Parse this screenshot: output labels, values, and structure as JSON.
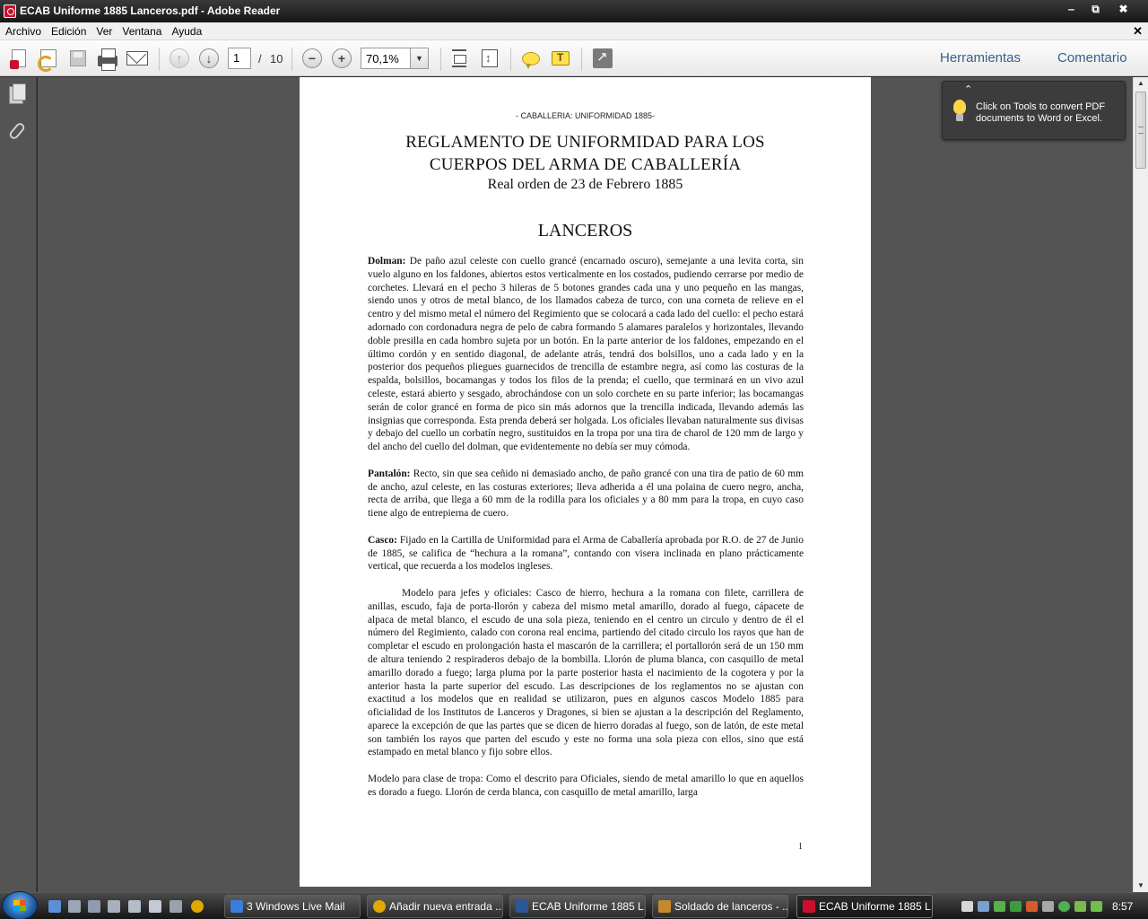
{
  "window": {
    "title": "ECAB Uniforme 1885 Lanceros.pdf - Adobe Reader",
    "minimize": "‒",
    "restore": "⧉",
    "close": "✖"
  },
  "menu": {
    "items": [
      "Archivo",
      "Edición",
      "Ver",
      "Ventana",
      "Ayuda"
    ],
    "doc_close": "✕"
  },
  "toolbar": {
    "page_current": "1",
    "page_separator": "/",
    "page_total": "10",
    "zoom": "70,1%",
    "zoom_arrow": "▼",
    "herramientas": "Herramientas",
    "comentario": "Comentario",
    "icons": {
      "create": "create-pdf-icon",
      "open": "open-icon",
      "save": "save-icon",
      "print": "print-icon",
      "email": "email-icon",
      "prev": "previous-page-icon",
      "next": "next-page-icon",
      "zoom_out": "zoom-out-icon",
      "zoom_in": "zoom-in-icon",
      "fit_page": "fit-page-icon",
      "fit_width": "fit-width-icon",
      "comment": "sticky-note-icon",
      "highlight": "highlight-text-icon",
      "fullscreen": "full-screen-icon"
    }
  },
  "tooltip": {
    "collapse": "⌃",
    "text": "Click on Tools to convert PDF documents to Word or Excel."
  },
  "document": {
    "header": "- CABALLERIA: UNIFORMIDAD 1885-",
    "title_line1": "REGLAMENTO DE UNIFORMIDAD PARA LOS",
    "title_line2": "CUERPOS DEL ARMA DE CABALLERÍA",
    "subtitle": "Real orden de 23 de Febrero 1885",
    "section": "LANCEROS",
    "paragraphs": [
      {
        "term": "Dolman:",
        "text": " De paño azul celeste con cuello grancé (encarnado oscuro), semejante a una levita corta, sin vuelo alguno en los faldones, abiertos estos verticalmente en los costados, pudiendo cerrarse por medio de corchetes. Llevará en el pecho 3 hileras de 5 botones grandes cada una y uno pequeño en las mangas, siendo unos y otros de metal blanco, de los llamados cabeza de turco, con una corneta de relieve en el centro y del mismo metal el número del Regimiento que se colocará a cada lado del cuello: el pecho estará adornado con cordonadura negra de pelo de cabra formando 5 alamares paralelos y horizontales, llevando doble presilla en cada hombro sujeta por un botón. En la parte anterior de los faldones, empezando en el último cordón y en sentido diagonal, de adelante atrás, tendrá dos bolsillos, uno a cada lado y en la posterior dos pequeños pliegues guarnecidos de trencilla de estambre negra, así como las costuras de la espalda, bolsillos, bocamangas y todos los filos de la prenda; el cuello, que terminará en un vivo azul celeste, estará abierto y sesgado, abrochándose con un solo corchete en su parte inferior; las bocamangas serán de color grancé en forma de pico sin más adornos que la trencilla indicada, llevando además las insignias que corresponda. Esta prenda deberá ser holgada. Los oficiales llevaban naturalmente sus divisas y debajo del cuello un corbatín negro, sustituidos en la tropa por una tira de charol de 120 mm de largo y del ancho del cuello del dolman, que evidentemente no debía ser muy cómoda."
      },
      {
        "term": "Pantalón:",
        "text": " Recto, sin que sea ceñido ni demasiado ancho, de paño grancé con una tira de patio de 60 mm de ancho, azul celeste, en las costuras exteriores; lleva adherida a él una polaina de cuero negro, ancha, recta de arriba, que llega a 60 mm de la rodilla para los oficiales y a 80 mm para la tropa, en cuyo caso tiene algo de entrepierna de cuero."
      },
      {
        "term": "Casco:",
        "text": " Fijado en la Cartilla de Uniformidad para el Arma de Caballería aprobada por R.O. de 27 de Junio de 1885, se califica de “hechura a la romana”, contando con visera inclinada en plano prácticamente vertical, que recuerda a los modelos ingleses."
      },
      {
        "term": "",
        "indent": true,
        "text": "Modelo para jefes y oficiales: Casco de hierro, hechura a la romana con filete, carrillera de anillas, escudo, faja de porta-llorón y cabeza del mismo metal amarillo, dorado al fuego, cápacete de alpaca de metal blanco, el escudo de una sola pieza, teniendo en el centro un circulo y dentro de él el número del Regimiento, calado con corona real encima, partiendo del citado circulo los rayos que han de completar el escudo en prolongación hasta el mascarón de la carrillera; el portallorón será de un 150 mm de altura teniendo 2 respiraderos debajo de la bombilla. Llorón de pluma blanca, con casquillo de metal amarillo dorado a fuego; larga pluma por la parte posterior hasta el nacimiento de la cogotera y por la anterior hasta la parte superior del escudo. Las descripciones de los reglamentos no se ajustan con exactitud a los modelos que en realidad se utilizaron, pues en algunos cascos Modelo 1885 para oficialidad de los Institutos de Lanceros y Dragones, si bien se ajustan a la descripción del Reglamento, aparece la excepción de que las partes que se dicen de hierro doradas al fuego, son de latón, de este metal son también los rayos que parten del escudo y este no forma una sola pieza con ellos, sino que está estampado en metal blanco y fijo sobre ellos."
      },
      {
        "term": "",
        "text": "Modelo para clase de tropa: Como el descrito para Oficiales, siendo de metal amarillo lo que en aquellos es dorado a fuego. Llorón de cerda blanca, con casquillo de metal amarillo, larga"
      }
    ],
    "page_number": "1"
  },
  "nav": {
    "pages_icon": "pages-panel-icon",
    "attachments_icon": "attachments-icon"
  },
  "scrollbar": {
    "up": "▲",
    "down": "▼"
  },
  "taskbar": {
    "windows": [
      {
        "label": "3 Windows Live Mail",
        "icon_color": "#3b7dd8"
      },
      {
        "label": "Añadir nueva entrada ...",
        "icon_color": "#e0a800"
      },
      {
        "label": "ECAB Uniforme 1885 L...",
        "icon_color": "#2b5797"
      },
      {
        "label": "Soldado de lanceros - ...",
        "icon_color": "#c28a2c"
      },
      {
        "label": "ECAB Uniforme 1885 L...",
        "icon_color": "#c8102e"
      }
    ],
    "clock": "8:57"
  }
}
